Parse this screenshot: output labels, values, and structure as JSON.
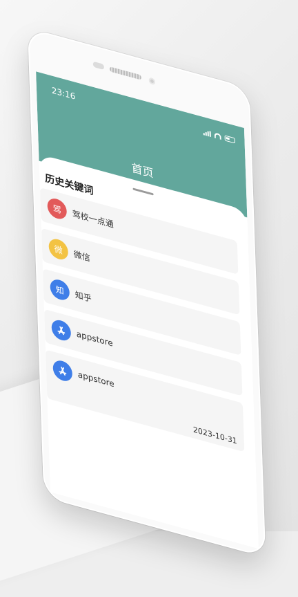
{
  "status": {
    "time": "23:16"
  },
  "header": {
    "title": "首页"
  },
  "history": {
    "section_title": "历史关键词",
    "items": [
      {
        "icon_char": "驾",
        "icon_color": "#e25a5a",
        "label": "驾校一点通"
      },
      {
        "icon_char": "微",
        "icon_color": "#f3c343",
        "label": "微信"
      },
      {
        "icon_char": "知",
        "icon_color": "#3f7ee8",
        "label": "知乎"
      },
      {
        "icon_name": "appstore-icon",
        "icon_color": "#3f7ee8",
        "label": "appstore"
      },
      {
        "icon_name": "appstore-icon",
        "icon_color": "#3f7ee8",
        "label": "appstore",
        "date": "2023-10-31"
      }
    ]
  },
  "colors": {
    "header_bg": "#62a79c"
  }
}
